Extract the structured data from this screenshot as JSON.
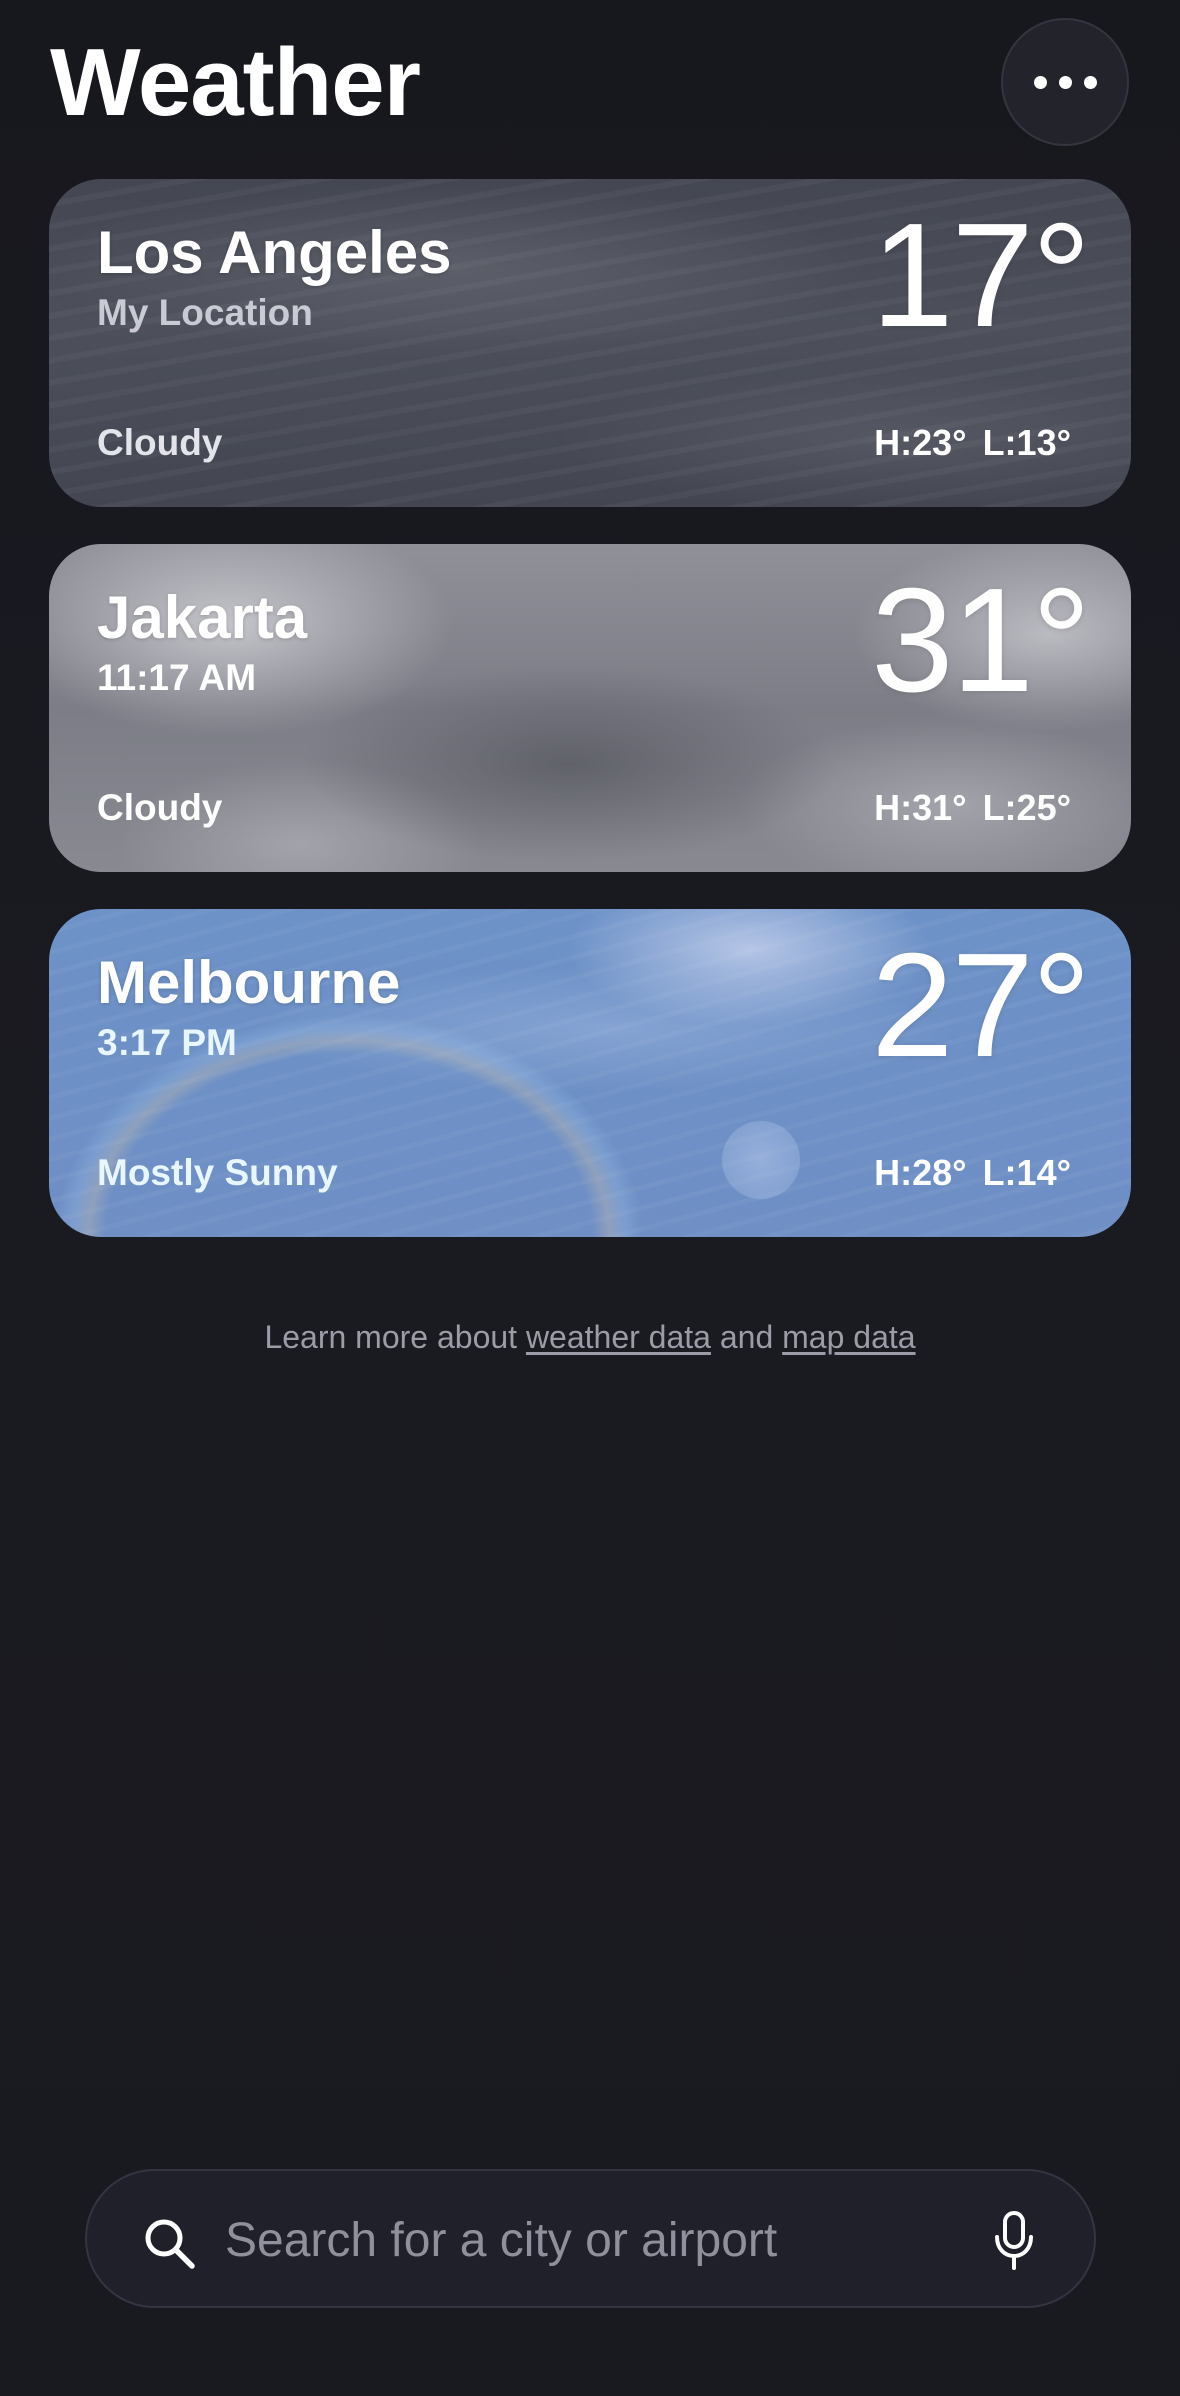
{
  "app": {
    "title": "Weather"
  },
  "header": {
    "more_icon": "ellipsis-icon"
  },
  "locations": [
    {
      "city": "Los Angeles",
      "subtitle": "My Location",
      "temperature": "17°",
      "condition": "Cloudy",
      "high_low": "H:23° L:13°"
    },
    {
      "city": "Jakarta",
      "subtitle": "11:17 AM",
      "temperature": "31°",
      "condition": "Cloudy",
      "high_low": "H:31° L:25°"
    },
    {
      "city": "Melbourne",
      "subtitle": "3:17 PM",
      "temperature": "27°",
      "condition": "Mostly Sunny",
      "high_low": "H:28° L:14°"
    }
  ],
  "footer": {
    "prefix": "Learn more about ",
    "weather_link": "weather data",
    "middle": " and ",
    "map_link": "map data"
  },
  "search": {
    "placeholder": "Search for a city or airport",
    "search_icon": "search-icon",
    "mic_icon": "microphone-icon"
  }
}
